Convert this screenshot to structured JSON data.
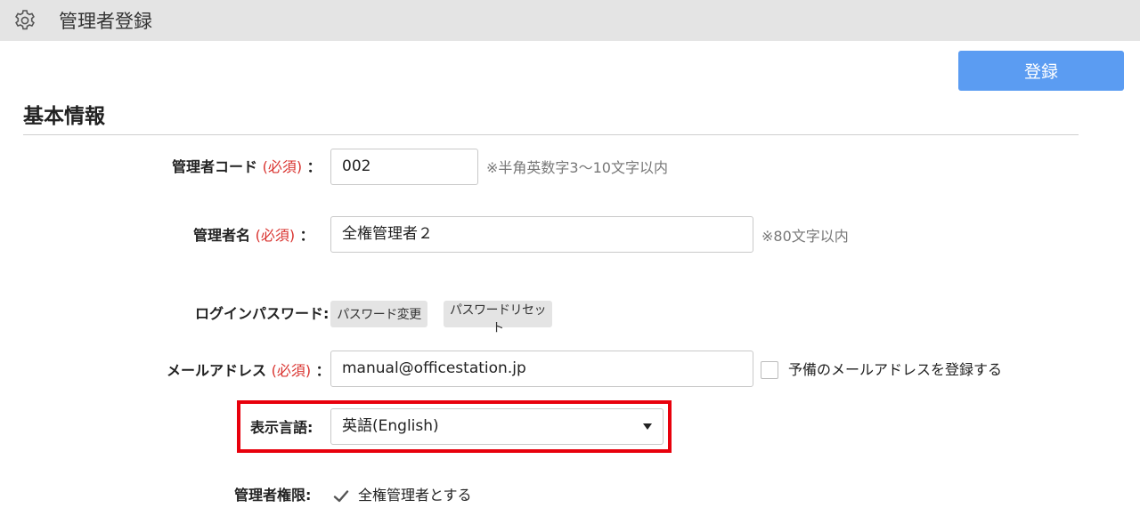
{
  "header": {
    "title": "管理者登録",
    "icon": "gear-icon"
  },
  "toolbar": {
    "register_label": "登録"
  },
  "section": {
    "title": "基本情報"
  },
  "form": {
    "admin_code": {
      "label": "管理者コード",
      "required": "(必須)",
      "colon": "：",
      "value": "002",
      "note": "※半角英数字3〜10文字以内"
    },
    "admin_name": {
      "label": "管理者名",
      "required": "(必須)",
      "colon": "：",
      "value": "全権管理者２",
      "note": "※80文字以内"
    },
    "login_password": {
      "label": "ログインパスワード:",
      "change_label": "パスワード変更",
      "reset_label": "パスワードリセット"
    },
    "email": {
      "label": "メールアドレス",
      "required": "(必須)",
      "colon": "：",
      "value": "manual@officestation.jp",
      "backup_label": "予備のメールアドレスを登録する",
      "backup_checked": false
    },
    "display_language": {
      "label": "表示言語:",
      "selected": "英語(English)"
    },
    "admin_permission": {
      "label": "管理者権限:",
      "full_admin_label": "全権管理者とする",
      "checked": true
    }
  },
  "colors": {
    "accent": "#5b9cf2",
    "required": "#d9332f",
    "highlight": "#e8000c",
    "header_bg": "#e4e4e4"
  }
}
